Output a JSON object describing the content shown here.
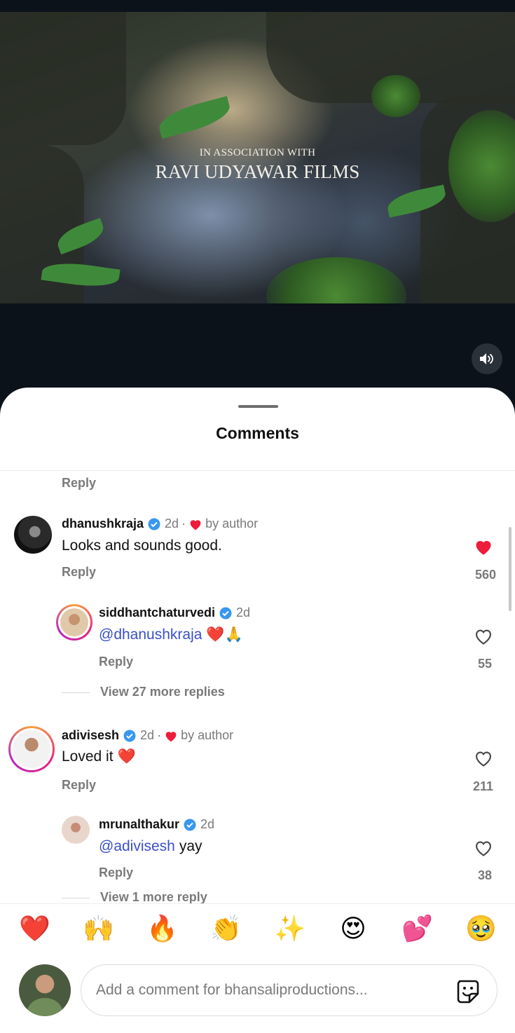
{
  "video": {
    "overlay_small": "IN ASSOCIATION WITH",
    "overlay_big": "RAVI UDYAWAR FILMS",
    "sound_icon": "speaker-icon"
  },
  "sheet": {
    "title": "Comments"
  },
  "comments": {
    "top_reply_label": "Reply",
    "c1": {
      "username": "dhanushkraja",
      "time": "2d",
      "by_author": "by author",
      "text": "Looks and sounds good.",
      "reply_label": "Reply",
      "likes": "560",
      "liked": true
    },
    "r1": {
      "username": "siddhantchaturvedi",
      "time": "2d",
      "mention": "@dhanushkraja",
      "emojis": "❤️🙏",
      "reply_label": "Reply",
      "likes": "55"
    },
    "view_more_1": "View 27 more replies",
    "c2": {
      "username": "adivisesh",
      "time": "2d",
      "by_author": "by author",
      "text": "Loved it",
      "emoji": "❤️",
      "reply_label": "Reply",
      "likes": "211"
    },
    "r2": {
      "username": "mrunalthakur",
      "time": "2d",
      "mention": "@adivisesh",
      "text": "yay",
      "reply_label": "Reply",
      "likes": "38"
    },
    "view_more_2": "View 1 more reply"
  },
  "emoji_bar": [
    "❤️",
    "🙌",
    "🔥",
    "👏",
    "✨",
    "😍",
    "💕",
    "🥹"
  ],
  "composer": {
    "placeholder": "Add a comment for bhansaliproductions...",
    "sticker_icon": "sticker-icon"
  },
  "colors": {
    "mention": "#3a50c9",
    "like_red": "#ee1d3a",
    "verified_blue": "#3897f0"
  }
}
